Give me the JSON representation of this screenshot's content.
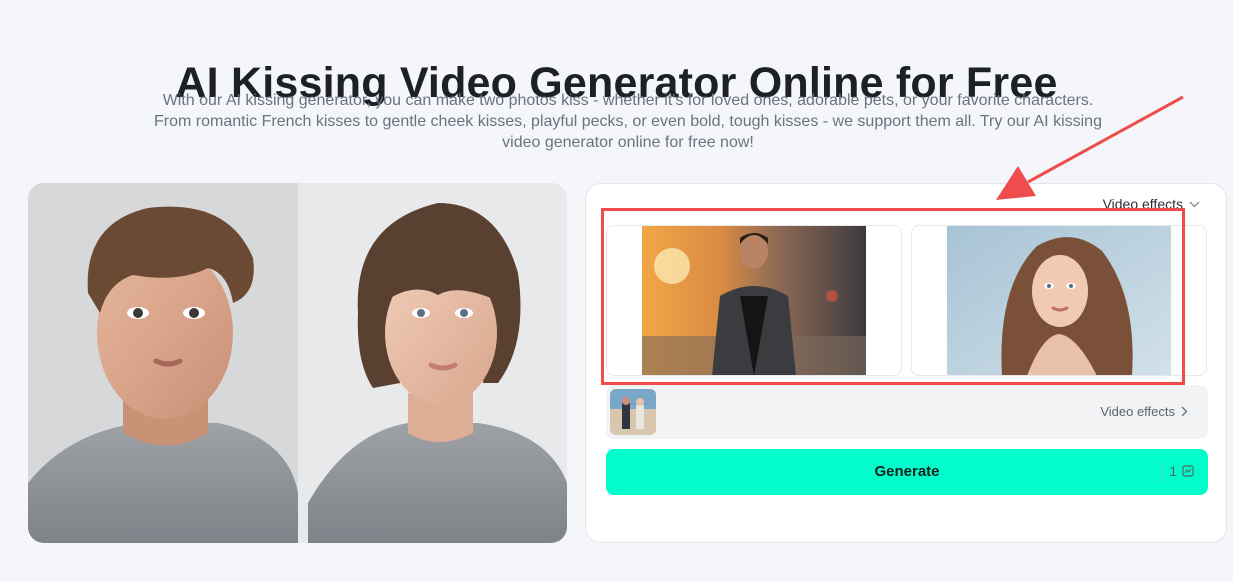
{
  "page": {
    "title": "AI Kissing Video Generator Online for Free",
    "description": "With our AI kissing generator, you can make two photos kiss - whether it's for loved ones, adorable pets, or your favorite characters. From romantic French kisses to gentle cheek kisses, playful pecks, or even bold, tough kisses - we support them all. Try our AI kissing video generator online for free now!"
  },
  "panel": {
    "effects_dropdown_label": "Video effects",
    "effects_row_label": "Video effects",
    "generate_label": "Generate",
    "credit_cost": "1"
  },
  "colors": {
    "accent": "#00fdcb",
    "highlight": "#ef4d4d"
  },
  "icons": {
    "dropdown": "chevron-down-icon",
    "effects_link": "chevron-right-icon",
    "credit": "credit-icon"
  }
}
